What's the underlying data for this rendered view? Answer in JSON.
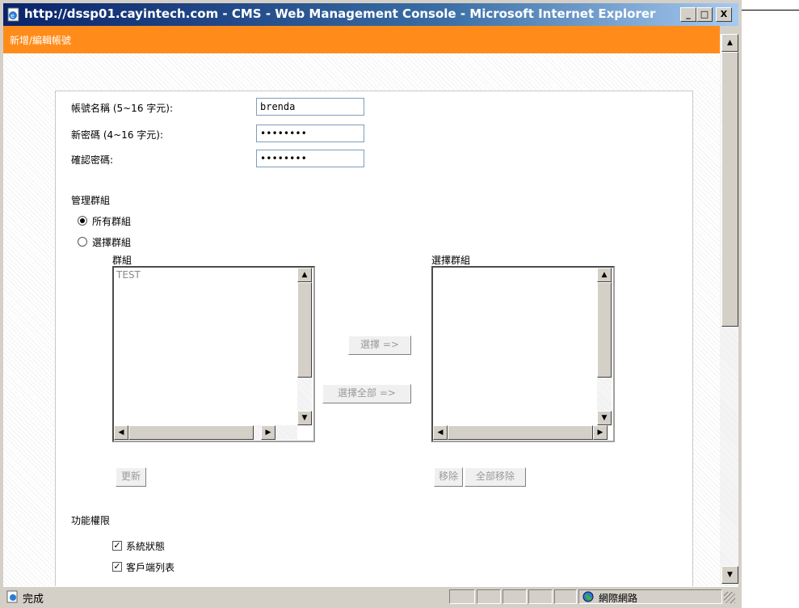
{
  "window": {
    "title": "http://dssp01.cayintech.com - CMS - Web Management Console - Microsoft Internet Explorer",
    "minimize": "_",
    "maximize": "□",
    "close": "X"
  },
  "header": {
    "title": "新增/編輯帳號"
  },
  "form": {
    "account_label": "帳號名稱 (5~16 字元):",
    "account_value": "brenda",
    "password_label": "新密碼 (4~16 字元):",
    "password_value": "••••••••",
    "confirm_label": "確認密碼:",
    "confirm_value": "••••••••"
  },
  "group_mgmt": {
    "section_label": "管理群組",
    "option_all": "所有群組",
    "option_select": "選擇群組",
    "selected_option": "所有群組",
    "groups_label": "群組",
    "groups": [
      "TEST"
    ],
    "selected_groups_label": "選擇群組",
    "select_button": "選擇 =>",
    "select_all_button": "選擇全部 =>",
    "update_button": "更新",
    "remove_button": "移除",
    "remove_all_button": "全部移除"
  },
  "permissions": {
    "section_label": "功能權限",
    "items": [
      {
        "label": "系統狀態",
        "checked": true
      },
      {
        "label": "客戶端列表",
        "checked": true
      }
    ]
  },
  "statusbar": {
    "status": "完成",
    "zone": "網際網路"
  },
  "icons": [
    "ie-page-icon",
    "globe-icon",
    "done-icon"
  ],
  "colors": {
    "header": "#ff8c1a",
    "titlebar": "#0a246a"
  }
}
